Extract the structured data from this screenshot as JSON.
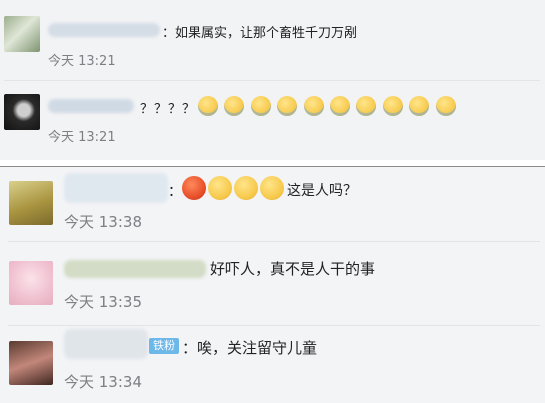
{
  "comments": [
    {
      "message": "：如果属实，让那个畜牲千刀万剐",
      "time": "今天 13:21"
    },
    {
      "message": "？？？？",
      "time": "今天 13:21"
    },
    {
      "message_sep": "：",
      "message": "这是人吗？",
      "time": "今天 13:38"
    },
    {
      "message": "好吓人，真不是人干的事",
      "time": "今天 13:35"
    },
    {
      "badge": "铁粉",
      "message": "：唉，关注留守儿童",
      "time": "今天 13:34"
    }
  ],
  "colors": {
    "badge_blue": "#6db7e9",
    "emoji_face": "#f6c84a",
    "emoji_angry": "#e8502a"
  },
  "icons": [
    "sweat-face-emoji",
    "angry-face-emoji",
    "confused-face-emoji"
  ]
}
